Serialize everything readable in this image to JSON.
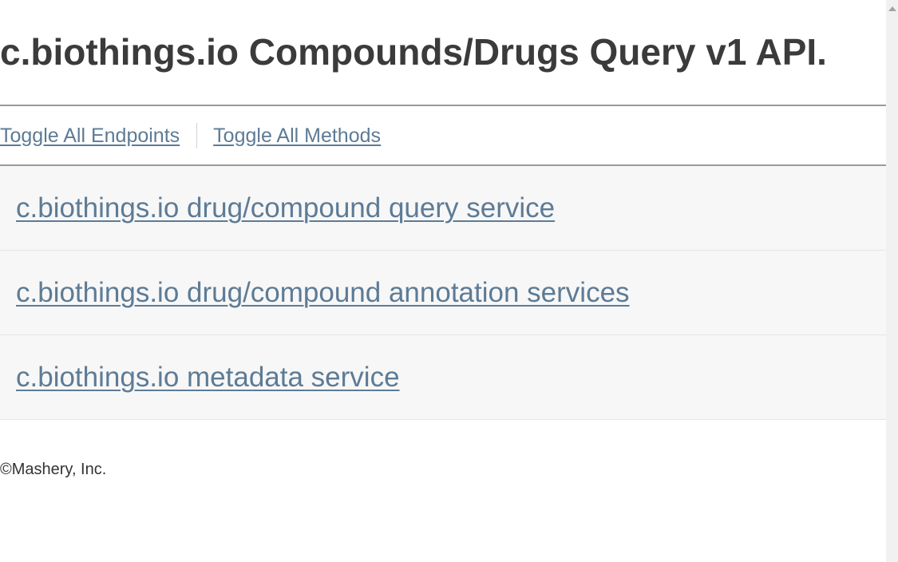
{
  "header": {
    "title": "c.biothings.io Compounds/Drugs Query v1 API."
  },
  "toolbar": {
    "toggle_endpoints": "Toggle All Endpoints",
    "toggle_methods": "Toggle All Methods"
  },
  "endpoints": [
    {
      "label": "c.biothings.io drug/compound query service"
    },
    {
      "label": "c.biothings.io drug/compound annotation services"
    },
    {
      "label": "c.biothings.io metadata service"
    }
  ],
  "footer": {
    "copyright": "©Mashery, Inc."
  },
  "colors": {
    "link": "#5d7b95",
    "title": "#3b3b3b",
    "endpoint_bg": "#f7f7f7",
    "rule": "#9a9a9a"
  },
  "icons": {
    "scroll_up": "scroll-up-arrow-icon"
  }
}
